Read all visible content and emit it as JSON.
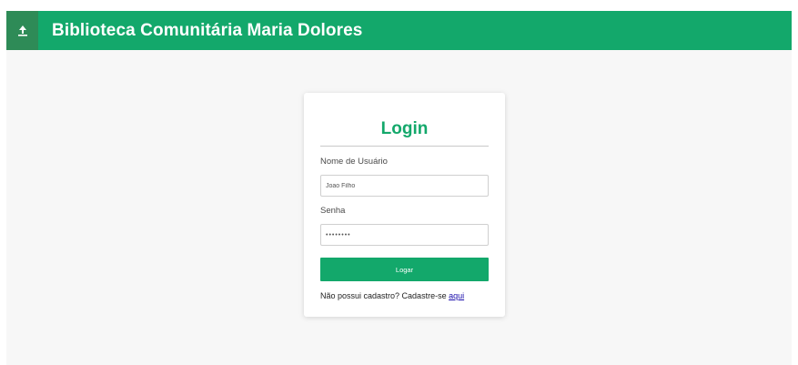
{
  "header": {
    "title": "Biblioteca Comunitária Maria Dolores",
    "logo_icon": "tree-icon",
    "background_color": "#13a86b",
    "logo_background_color": "#2e8b57"
  },
  "login": {
    "title": "Login",
    "username_label": "Nome de Usuário",
    "username_value": "Joao Filho",
    "password_label": "Senha",
    "password_value": "••••••••",
    "submit_label": "Logar",
    "signup_prompt": "Não possui cadastro? Cadastre-se",
    "signup_link": "aqui",
    "accent_color": "#13a86b"
  }
}
